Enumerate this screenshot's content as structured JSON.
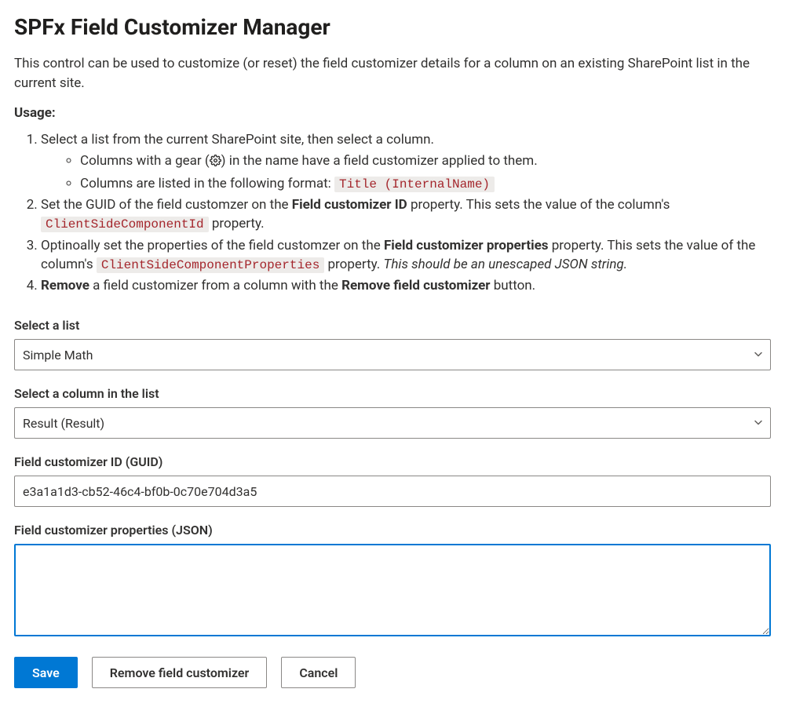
{
  "title": "SPFx Field Customizer Manager",
  "intro": "This control can be used to customize (or reset) the field customizer details for a column on an existing SharePoint list in the current site.",
  "usage_label": "Usage:",
  "usage": {
    "step1": "Select a list from the current SharePoint site, then select a column.",
    "step1_sub_a_pre": "Columns with a gear (",
    "step1_sub_a_post": ") in the name have a field customizer applied to them.",
    "step1_sub_b_pre": "Columns are listed in the following format: ",
    "step1_sub_b_code": "Title (InternalName)",
    "step2_pre": "Set the GUID of the field customzer on the ",
    "step2_bold": "Field customizer ID",
    "step2_mid": " property. This sets the value of the column's ",
    "step2_code": "ClientSideComponentId",
    "step2_post": " property.",
    "step3_pre": "Optinoally set the properties of the field customzer on the ",
    "step3_bold": "Field customizer properties",
    "step3_mid": " property. This sets the value of the column's ",
    "step3_code": "ClientSideComponentProperties",
    "step3_post1": " property. ",
    "step3_italic": "This should be an unescaped JSON string.",
    "step4_bold1": "Remove",
    "step4_mid": " a field customizer from a column with the ",
    "step4_bold2": "Remove field customizer",
    "step4_post": " button."
  },
  "fields": {
    "select_list_label": "Select a list",
    "select_list_value": "Simple Math",
    "select_column_label": "Select a column in the list",
    "select_column_value": "Result (Result)",
    "guid_label": "Field customizer ID (GUID)",
    "guid_value": "e3a1a1d3-cb52-46c4-bf0b-0c70e704d3a5",
    "props_label": "Field customizer properties (JSON)",
    "props_value": ""
  },
  "buttons": {
    "save": "Save",
    "remove": "Remove field customizer",
    "cancel": "Cancel"
  }
}
